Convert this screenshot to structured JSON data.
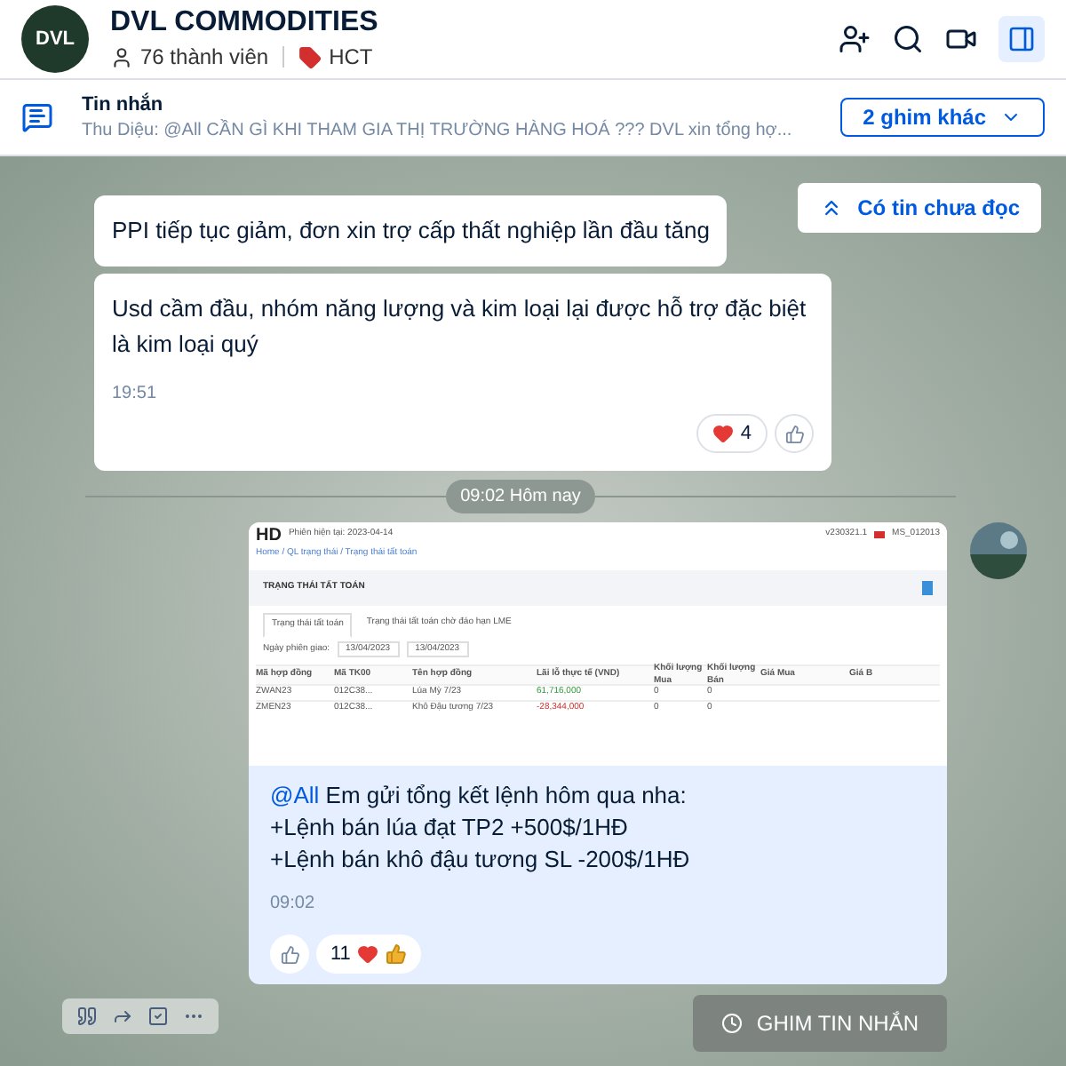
{
  "header": {
    "group_name": "DVL COMMODITIES",
    "logo_text": "DVL",
    "members": "76 thành viên",
    "tag": "HCT"
  },
  "pinned": {
    "label": "Tin nhắn",
    "preview": "Thu Diệu: @All CẦN GÌ KHI THAM GIA THỊ TRƯỜNG HÀNG HOÁ ??? DVL xin tổng hợ...",
    "more_button": "2 ghim khác"
  },
  "unread_button": "Có tin chưa đọc",
  "messages": [
    {
      "kind": "text",
      "text": "PPI tiếp tục giảm, đơn xin trợ cấp thất nghiệp lần đầu tăng"
    },
    {
      "kind": "text",
      "text": "Usd cầm đầu, nhóm năng lượng và kim loại lại được hỗ trợ đặc biệt là kim loại quý",
      "time": "19:51",
      "reaction_count": "4"
    }
  ],
  "date_divider": "09:02 Hôm nay",
  "shared": {
    "brand": "HD",
    "session": "Phiên hiện tại: 2023-04-14",
    "version": "v230321.1",
    "user": "MS_012013",
    "breadcrumb": "Home / QL trạng thái / Trạng thái tất toán",
    "title": "TRẠNG THÁI TẤT TOÁN",
    "tabs": [
      {
        "label": "Trạng thái tất toán",
        "selected": true
      },
      {
        "label": "Trạng thái tất toán chờ đáo hạn LME",
        "selected": false
      }
    ],
    "date_label": "Ngày phiên giao:",
    "date_from": "13/04/2023",
    "date_to": "13/04/2023",
    "columns": [
      "Mã hợp đồng",
      "Mã TK00",
      "Tên hợp đồng",
      "Lãi lỗ thực tế (VND)",
      "Khối lượng Mua",
      "Khối lượng Bán",
      "Giá Mua",
      "Giá B"
    ],
    "rows": [
      {
        "cells": [
          "ZWAN23",
          "012C38...",
          "Lúa Mỳ 7/23",
          "61,716,000",
          "0",
          "0"
        ],
        "profit": true
      },
      {
        "cells": [
          "ZMEN23",
          "012C38...",
          "Khô Đậu tương 7/23",
          "-28,344,000",
          "0",
          "0"
        ],
        "profit": false
      }
    ]
  },
  "report": {
    "mention": "@All",
    "lines": [
      " Em gửi tổng kết lệnh hôm qua nha:",
      "+Lệnh bán lúa đạt TP2 +500$/1HĐ",
      "+Lệnh bán khô đậu tương SL -200$/1HĐ"
    ],
    "time": "09:02",
    "reaction_count": "11"
  },
  "pin_button": "GHIM TIN NHẮN"
}
